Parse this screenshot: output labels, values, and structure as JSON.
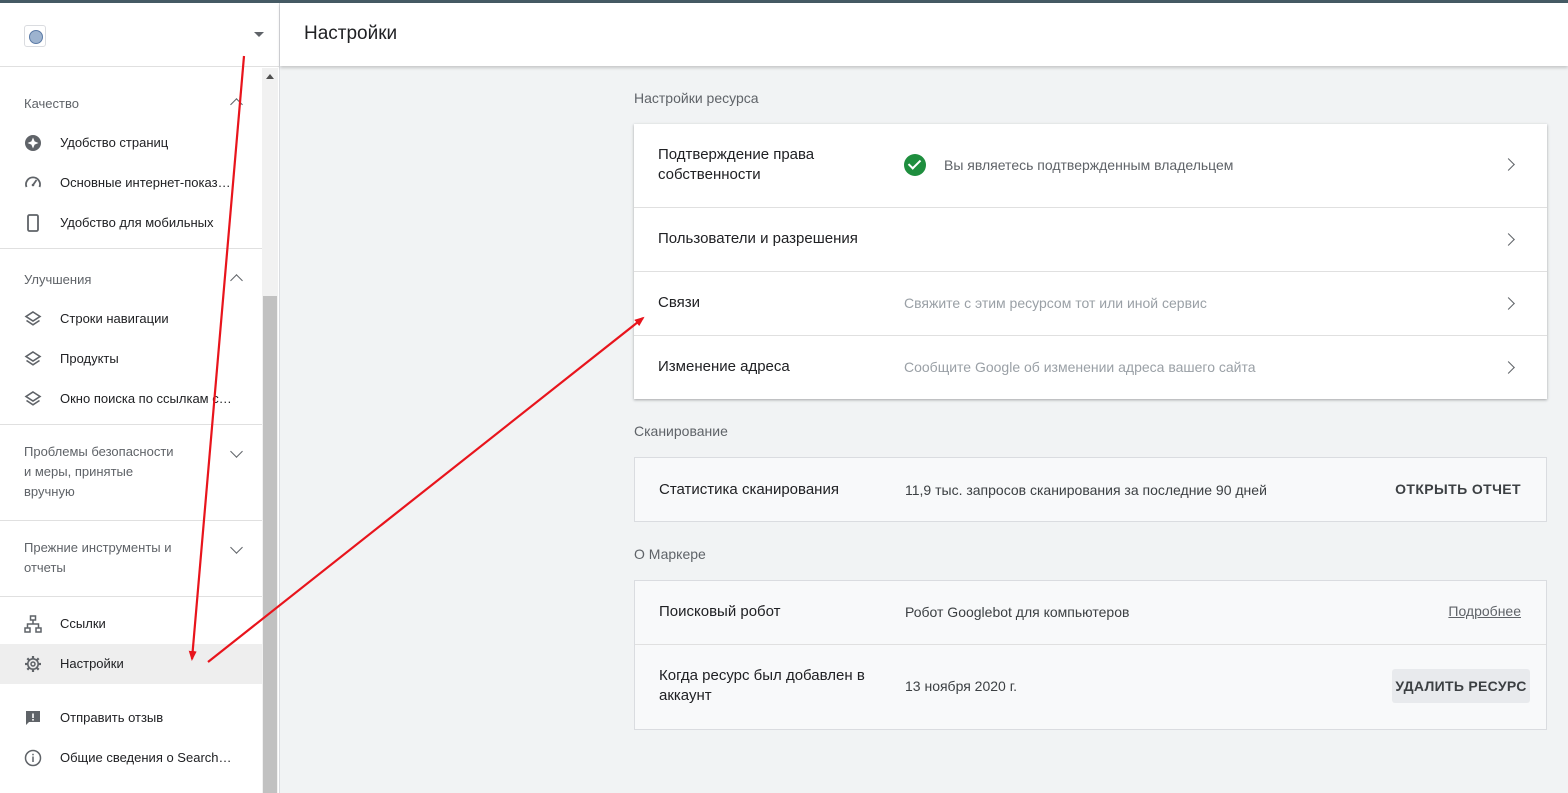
{
  "property": {
    "name": ""
  },
  "sidebar": {
    "sections": [
      {
        "title": "Качество",
        "items": [
          {
            "label": "Удобство страниц",
            "icon": "page-experience-icon"
          },
          {
            "label": "Основные интернет-показатели",
            "icon": "speedometer-icon"
          },
          {
            "label": "Удобство для мобильных",
            "icon": "mobile-phone-icon"
          }
        ]
      },
      {
        "title": "Улучшения",
        "items": [
          {
            "label": "Строки навигации",
            "icon": "layers-icon"
          },
          {
            "label": "Продукты",
            "icon": "layers-icon"
          },
          {
            "label": "Окно поиска по ссылкам сайта",
            "icon": "layers-icon"
          }
        ]
      },
      {
        "title": "Проблемы безопасности и меры, принятые вручную"
      },
      {
        "title": "Прежние инструменты и отчеты"
      }
    ],
    "links_label": "Ссылки",
    "settings_label": "Настройки",
    "feedback_label": "Отправить отзыв",
    "about_label": "Общие сведения о Search Console"
  },
  "header": {
    "title": "Настройки"
  },
  "resource_settings": {
    "title": "Настройки ресурса",
    "rows": [
      {
        "label": "Подтверждение права собственности",
        "desc": "Вы являетесь подтвержденным владельцем"
      },
      {
        "label": "Пользователи и разрешения",
        "desc": ""
      },
      {
        "label": "Связи",
        "desc": "Свяжите с этим ресурсом тот или иной сервис"
      },
      {
        "label": "Изменение адреса",
        "desc": "Сообщите Google об изменении адреса вашего сайта"
      }
    ]
  },
  "crawling": {
    "title": "Сканирование",
    "label": "Статистика сканирования",
    "desc": "11,9 тыс. запросов сканирования за последние 90 дней",
    "button": "ОТКРЫТЬ ОТЧЕТ"
  },
  "about": {
    "title": "О Маркере",
    "crawler_label": "Поисковый робот",
    "crawler_value": "Робот Googlebot для компьютеров",
    "more_link": "Подробнее",
    "added_label": "Когда ресурс был добавлен в аккаунт",
    "added_value": "13 ноября 2020 г.",
    "delete_button": "УДАЛИТЬ РЕСУРС"
  },
  "colors": {
    "accent_arrow": "#e8141c",
    "verified_green": "#1e8e3e",
    "top_bar": "#455a64"
  }
}
